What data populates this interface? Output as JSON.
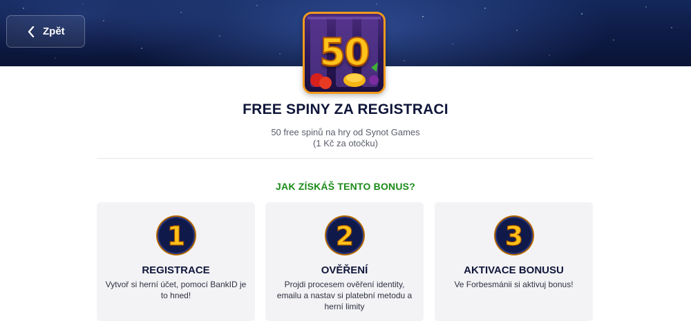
{
  "header": {
    "back_label": "Zpět",
    "back_icon": "chevron-left-icon"
  },
  "badge": {
    "number": "50"
  },
  "offer": {
    "title": "FREE SPINY ZA REGISTRACI",
    "subtitle_line1": "50 free spinů na hry od Synot Games",
    "subtitle_line2": "(1 Kč za otočku)"
  },
  "steps_section": {
    "heading": "JAK ZÍSKÁŠ TENTO BONUS?",
    "steps": [
      {
        "number": "1",
        "title": "REGISTRACE",
        "description": "Vytvoř si herní účet, pomocí BankID je to hned!"
      },
      {
        "number": "2",
        "title": "OVĚŘENÍ",
        "description": "Projdi procesem ověření identity, emailu a nastav si platební metodu a herní limity"
      },
      {
        "number": "3",
        "title": "AKTIVACE BONUSU",
        "description": "Ve Forbesmánii si aktivuj bonus!"
      }
    ]
  },
  "colors": {
    "hero_bg": "#0d1a44",
    "title": "#10163a",
    "heading_green": "#1a8a17",
    "card_bg": "#f3f3f5",
    "number_gold": "#ffc21a",
    "number_circle": "#0f1a4a"
  }
}
